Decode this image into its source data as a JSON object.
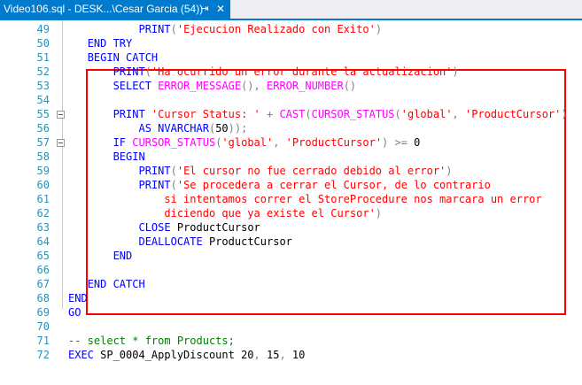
{
  "tab": {
    "title": "Video106.sql - DESK...\\Cesar Garcia (54))",
    "pin_icon": "pin-icon",
    "close_icon": "close-icon"
  },
  "colors": {
    "tab_active": "#007acc",
    "keyword": "#0000ff",
    "string": "#ff0000",
    "function": "#ff00ff",
    "operator": "#808080",
    "comment": "#008000",
    "line_number": "#2b91af",
    "highlight_box": "#ff0000"
  },
  "lines": [
    {
      "n": "49",
      "t": [
        [
          "           ",
          "id"
        ],
        [
          "PRINT",
          "kw"
        ],
        [
          "(",
          "gr"
        ],
        [
          "'Ejecucion Realizado con Exito'",
          "str"
        ],
        [
          ")",
          "gr"
        ]
      ]
    },
    {
      "n": "50",
      "t": [
        [
          "   ",
          "id"
        ],
        [
          "END TRY",
          "kw"
        ]
      ]
    },
    {
      "n": "51",
      "t": [
        [
          "   ",
          "id"
        ],
        [
          "BEGIN CATCH",
          "kw"
        ]
      ]
    },
    {
      "n": "52",
      "t": [
        [
          "       ",
          "id"
        ],
        [
          "PRINT",
          "kw"
        ],
        [
          "(",
          "gr"
        ],
        [
          "'Ha ocurrido un error durante la actualizacion'",
          "str"
        ],
        [
          ")",
          "gr"
        ]
      ]
    },
    {
      "n": "53",
      "t": [
        [
          "       ",
          "id"
        ],
        [
          "SELECT ",
          "kw"
        ],
        [
          "ERROR_MESSAGE",
          "fn"
        ],
        [
          "(),",
          "gr"
        ],
        [
          " ",
          "id"
        ],
        [
          "ERROR_NUMBER",
          "fn"
        ],
        [
          "()",
          "gr"
        ]
      ]
    },
    {
      "n": "54",
      "t": []
    },
    {
      "n": "55",
      "t": [
        [
          "       ",
          "id"
        ],
        [
          "PRINT ",
          "kw"
        ],
        [
          "'Cursor Status: '",
          "str"
        ],
        [
          " + ",
          "gr"
        ],
        [
          "CAST",
          "fn"
        ],
        [
          "(",
          "gr"
        ],
        [
          "CURSOR_STATUS",
          "fn"
        ],
        [
          "(",
          "gr"
        ],
        [
          "'global'",
          "str"
        ],
        [
          ", ",
          "gr"
        ],
        [
          "'ProductCursor'",
          "str"
        ],
        [
          ")",
          "gr"
        ]
      ]
    },
    {
      "n": "56",
      "t": [
        [
          "           ",
          "id"
        ],
        [
          "AS ",
          "kw"
        ],
        [
          "NVARCHAR",
          "kw"
        ],
        [
          "(",
          "gr"
        ],
        [
          "50",
          "id"
        ],
        [
          "));",
          "gr"
        ]
      ]
    },
    {
      "n": "57",
      "t": [
        [
          "       ",
          "id"
        ],
        [
          "IF ",
          "kw"
        ],
        [
          "CURSOR_STATUS",
          "fn"
        ],
        [
          "(",
          "gr"
        ],
        [
          "'global'",
          "str"
        ],
        [
          ", ",
          "gr"
        ],
        [
          "'ProductCursor'",
          "str"
        ],
        [
          ") >= ",
          "gr"
        ],
        [
          "0",
          "id"
        ]
      ]
    },
    {
      "n": "58",
      "t": [
        [
          "       ",
          "id"
        ],
        [
          "BEGIN",
          "kw"
        ]
      ]
    },
    {
      "n": "59",
      "t": [
        [
          "           ",
          "id"
        ],
        [
          "PRINT",
          "kw"
        ],
        [
          "(",
          "gr"
        ],
        [
          "'El cursor no fue cerrado debido al error'",
          "str"
        ],
        [
          ")",
          "gr"
        ]
      ]
    },
    {
      "n": "60",
      "t": [
        [
          "           ",
          "id"
        ],
        [
          "PRINT",
          "kw"
        ],
        [
          "(",
          "gr"
        ],
        [
          "'Se procedera a cerrar el Cursor, de lo contrario",
          "str"
        ]
      ]
    },
    {
      "n": "61",
      "t": [
        [
          "               ",
          "id"
        ],
        [
          "si intentamos correr el StoreProcedure nos marcara un error",
          "str"
        ]
      ]
    },
    {
      "n": "62",
      "t": [
        [
          "               ",
          "id"
        ],
        [
          "diciendo que ya existe el Cursor'",
          "str"
        ],
        [
          ")",
          "gr"
        ]
      ]
    },
    {
      "n": "63",
      "t": [
        [
          "           ",
          "id"
        ],
        [
          "CLOSE ",
          "kw"
        ],
        [
          "ProductCursor",
          "id"
        ]
      ]
    },
    {
      "n": "64",
      "t": [
        [
          "           ",
          "id"
        ],
        [
          "DEALLOCATE ",
          "kw"
        ],
        [
          "ProductCursor",
          "id"
        ]
      ]
    },
    {
      "n": "65",
      "t": [
        [
          "       ",
          "id"
        ],
        [
          "END",
          "kw"
        ]
      ]
    },
    {
      "n": "66",
      "t": []
    },
    {
      "n": "67",
      "t": [
        [
          "   ",
          "id"
        ],
        [
          "END CATCH",
          "kw"
        ]
      ]
    },
    {
      "n": "68",
      "t": [
        [
          "END",
          "kw"
        ]
      ]
    },
    {
      "n": "69",
      "t": [
        [
          "GO",
          "kw"
        ]
      ]
    },
    {
      "n": "70",
      "t": []
    },
    {
      "n": "71",
      "t": [
        [
          "-- select * from Products;",
          "cm"
        ]
      ]
    },
    {
      "n": "72",
      "t": [
        [
          "EXEC ",
          "kw"
        ],
        [
          "SP_0004_ApplyDiscount ",
          "id"
        ],
        [
          "20",
          "id"
        ],
        [
          ", ",
          "gr"
        ],
        [
          "15",
          "id"
        ],
        [
          ", ",
          "gr"
        ],
        [
          "10",
          "id"
        ]
      ]
    }
  ],
  "fold_markers": [
    "55",
    "57"
  ]
}
